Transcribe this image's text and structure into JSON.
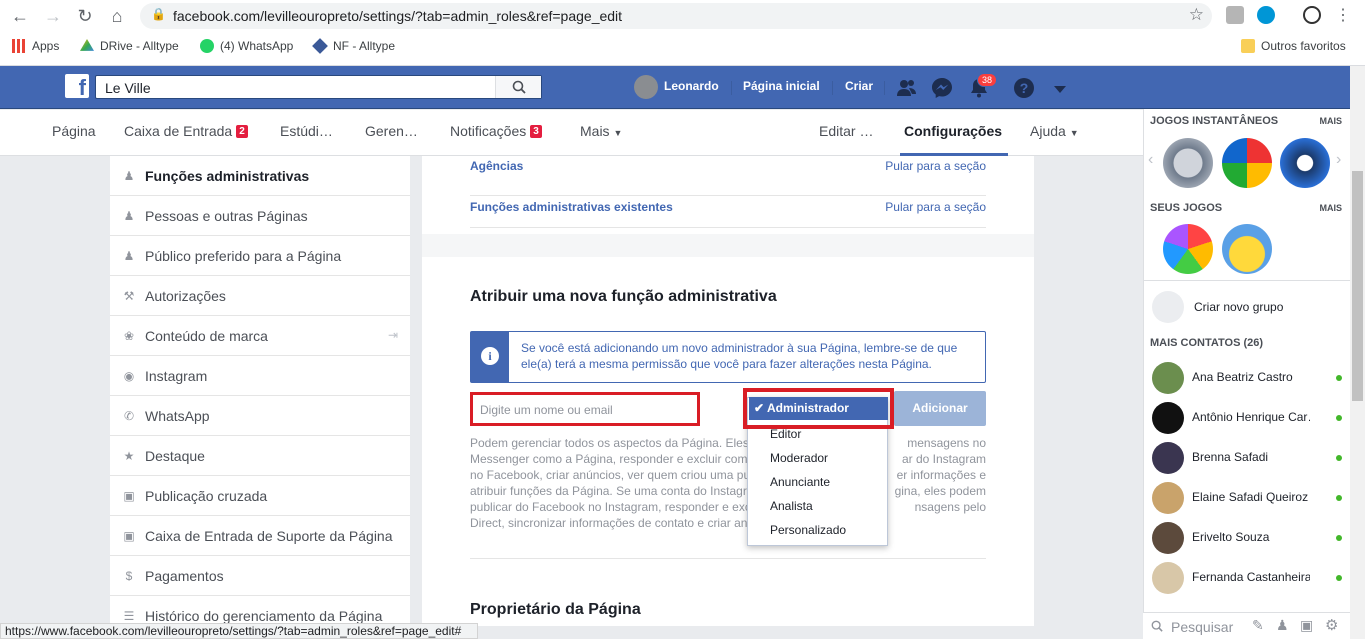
{
  "browser": {
    "url": "facebook.com/levilleouropreto/settings/?tab=admin_roles&ref=page_edit",
    "bookmarks": [
      "Apps",
      "DRive - Alltype",
      "(4) WhatsApp",
      "NF - Alltype"
    ],
    "other_bookmarks": "Outros favoritos",
    "status_url": "https://www.facebook.com/levilleouropreto/settings/?tab=admin_roles&ref=page_edit#"
  },
  "topbar": {
    "search_value": "Le Ville",
    "user_name": "Leonardo",
    "home_label": "Página inicial",
    "create_label": "Criar",
    "notifications_count": "38"
  },
  "page_nav": {
    "items": [
      {
        "label": "Página"
      },
      {
        "label": "Caixa de Entrada",
        "badge": "2"
      },
      {
        "label": "Estúdi…"
      },
      {
        "label": "Geren…"
      },
      {
        "label": "Notificações",
        "badge": "3"
      },
      {
        "label": "Mais"
      },
      {
        "label": "Editar …"
      },
      {
        "label": "Configurações"
      },
      {
        "label": "Ajuda"
      }
    ]
  },
  "settings_menu": [
    "Funções administrativas",
    "Pessoas e outras Páginas",
    "Público preferido para a Página",
    "Autorizações",
    "Conteúdo de marca",
    "Instagram",
    "WhatsApp",
    "Destaque",
    "Publicação cruzada",
    "Caixa de Entrada de Suporte da Página",
    "Pagamentos",
    "Histórico do gerenciamento da Página"
  ],
  "content": {
    "sections": [
      {
        "title": "Agências",
        "skip": "Pular para a seção"
      },
      {
        "title": "Funções administrativas existentes",
        "skip": "Pular para a seção"
      }
    ],
    "assign_title": "Atribuir uma nova função administrativa",
    "info_text": "Se você está adicionando um novo administrador à sua Página, lembre-se de que ele(a) terá a mesma permissão que você para fazer alterações nesta Página.",
    "name_placeholder": "Digite um nome ou email",
    "add_button": "Adicionar",
    "desc_lines": [
      "Podem gerenciar todos os aspectos da Página. Eles",
      "Messenger como a Página, responder e excluir come",
      "no Facebook, criar anúncios, ver quem criou uma pu",
      "atribuir funções da Página. Se uma conta do Instagra",
      "publicar do Facebook no Instagram, responder e exc",
      "Direct, sincronizar informações de contato e criar an"
    ],
    "desc_right": [
      "mensagens no",
      "ar do Instagram",
      "er informações e",
      "gina, eles podem",
      "nsagens pelo",
      ""
    ],
    "owner_title": "Proprietário da Página"
  },
  "role_dropdown": {
    "selected": "Administrador",
    "options": [
      "Editor",
      "Moderador",
      "Anunciante",
      "Analista",
      "Personalizado"
    ]
  },
  "right_col": {
    "instant_games": "JOGOS INSTANTÂNEOS",
    "more": "MAIS",
    "my_games": "SEUS JOGOS",
    "new_group": "Criar novo grupo",
    "more_contacts": "MAIS CONTATOS (26)",
    "contacts": [
      "Ana Beatriz Castro",
      "Antônio Henrique Car…",
      "Brenna Safadi",
      "Elaine Safadi Queiroz",
      "Erivelto Souza",
      "Fernanda Castanheira"
    ],
    "search_placeholder": "Pesquisar"
  }
}
